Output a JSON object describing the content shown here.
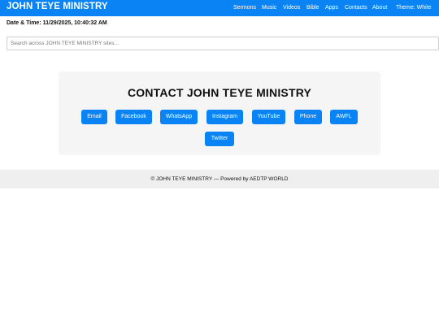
{
  "header": {
    "brand": "JOHN TEYE MINISTRY",
    "nav": [
      "Sermons",
      "Music",
      "Videos",
      "Bible",
      "Apps",
      "Contacts",
      "About",
      "Theme: White"
    ]
  },
  "datetime": {
    "label": "Date & Time:",
    "value": "11/29/2025, 10:40:32 AM"
  },
  "search": {
    "placeholder": "Search across JOHN TEYE MINISTRY sites..."
  },
  "contact": {
    "title": "CONTACT JOHN TEYE MINISTRY",
    "buttons": [
      "Email",
      "Facebook",
      "WhatsApp",
      "Instagram",
      "YouTube",
      "Phone",
      "AWFL",
      "Twitter"
    ]
  },
  "footer": {
    "text": "© JOHN TEYE MINISTRY — Powered by AEDTP WORLD"
  },
  "colors": {
    "accent": "#0a84f5",
    "card_bg": "#f5f5f5",
    "footer_bg": "#efefef"
  }
}
